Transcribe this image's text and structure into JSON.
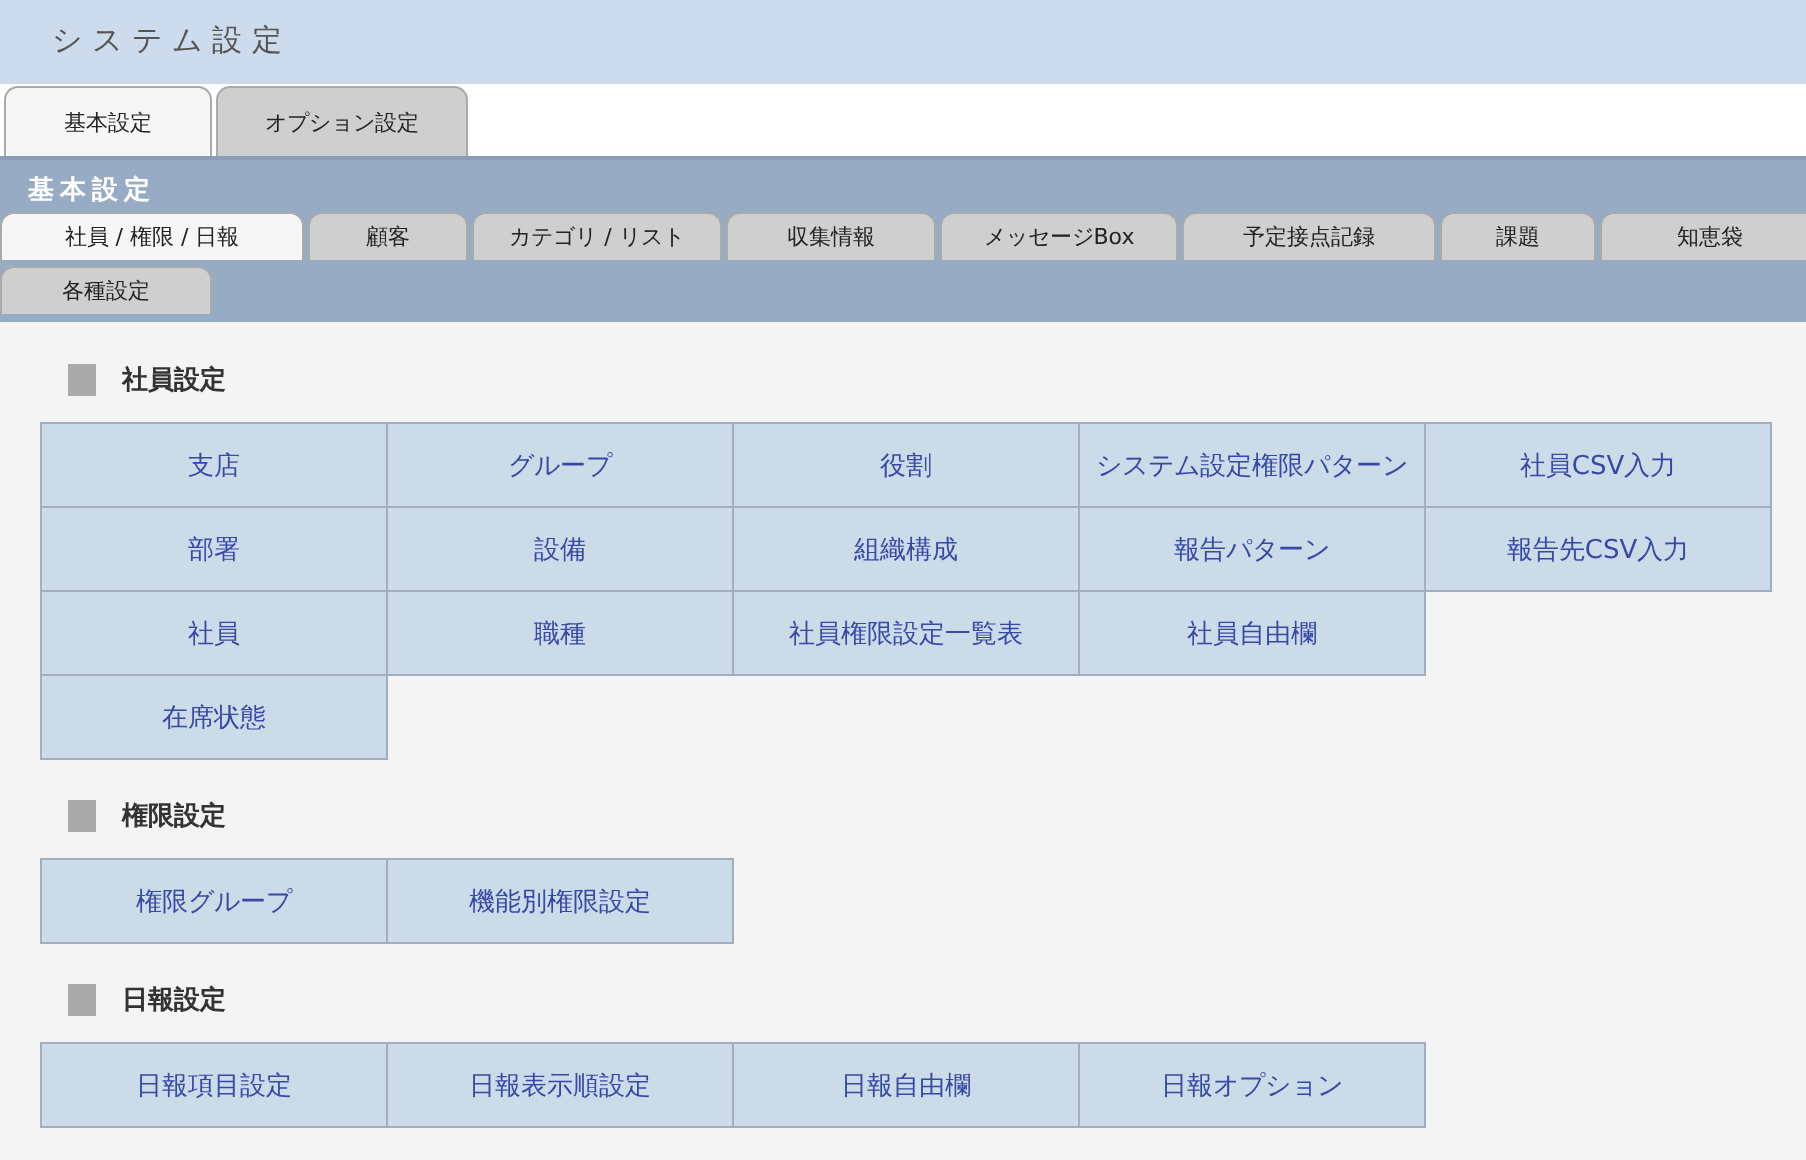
{
  "header": {
    "title": "システム設定"
  },
  "main_tabs": [
    {
      "label": "基本設定",
      "selected": true
    },
    {
      "label": "オプション設定",
      "selected": false
    }
  ],
  "panel": {
    "title": "基本設定",
    "tab_rows": [
      [
        {
          "label": "社員 / 権限 / 日報",
          "selected": true
        },
        {
          "label": "顧客",
          "selected": false
        },
        {
          "label": "カテゴリ / リスト",
          "selected": false
        },
        {
          "label": "収集情報",
          "selected": false
        },
        {
          "label": "メッセージBox",
          "selected": false
        },
        {
          "label": "予定接点記録",
          "selected": false
        },
        {
          "label": "課題",
          "selected": false
        },
        {
          "label": "知恵袋",
          "selected": false
        }
      ],
      [
        {
          "label": "各種設定",
          "selected": false
        }
      ]
    ]
  },
  "sections": [
    {
      "title": "社員設定",
      "rows": [
        [
          "支店",
          "グループ",
          "役割",
          "システム設定権限パターン",
          "社員CSV入力"
        ],
        [
          "部署",
          "設備",
          "組織構成",
          "報告パターン",
          "報告先CSV入力"
        ],
        [
          "社員",
          "職種",
          "社員権限設定一覧表",
          "社員自由欄"
        ],
        [
          "在席状態"
        ]
      ]
    },
    {
      "title": "権限設定",
      "rows": [
        [
          "権限グループ",
          "機能別権限設定"
        ]
      ]
    },
    {
      "title": "日報設定",
      "rows": [
        [
          "日報項目設定",
          "日報表示順設定",
          "日報自由欄",
          "日報オプション"
        ]
      ]
    }
  ]
}
